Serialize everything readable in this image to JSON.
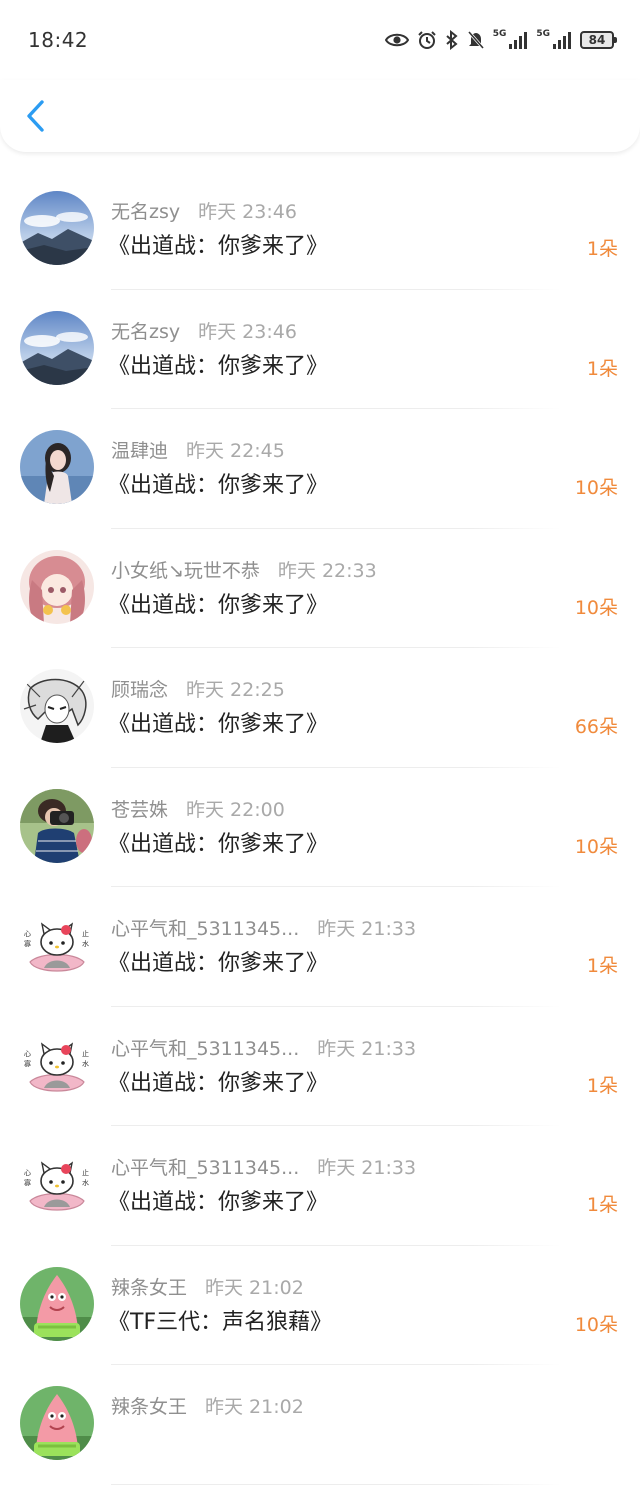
{
  "status_bar": {
    "time": "18:42",
    "network_1": "5G",
    "network_2": "5G",
    "battery": "84",
    "icons": [
      "eye-icon",
      "alarm-icon",
      "bluetooth-icon",
      "mute-icon",
      "signal-icon",
      "signal-icon"
    ]
  },
  "header": {
    "back_icon": "chevron-left-icon",
    "accent_color": "#2b9cf2"
  },
  "colors": {
    "amount": "#f08a3c",
    "name": "#8f8f8f",
    "title": "#222222"
  },
  "gifts": [
    {
      "user": "无名zsy",
      "time": "昨天 23:46",
      "title": "《出道战：你爹来了》",
      "amount": "1朵",
      "avatar": "mountain"
    },
    {
      "user": "无名zsy",
      "time": "昨天 23:46",
      "title": "《出道战：你爹来了》",
      "amount": "1朵",
      "avatar": "mountain"
    },
    {
      "user": "温肆迪",
      "time": "昨天 22:45",
      "title": "《出道战：你爹来了》",
      "amount": "10朵",
      "avatar": "girl"
    },
    {
      "user": "小女纸↘玩世不恭",
      "time": "昨天 22:33",
      "title": "《出道战：你爹来了》",
      "amount": "10朵",
      "avatar": "pink-anime"
    },
    {
      "user": "顾瑞念",
      "time": "昨天 22:25",
      "title": "《出道战：你爹来了》",
      "amount": "66朵",
      "avatar": "sketch"
    },
    {
      "user": "苍芸姝",
      "time": "昨天 22:00",
      "title": "《出道战：你爹来了》",
      "amount": "10朵",
      "avatar": "photographer"
    },
    {
      "user": "心平气和_5311345...",
      "time": "昨天 21:33",
      "title": "《出道战：你爹来了》",
      "amount": "1朵",
      "avatar": "kitty"
    },
    {
      "user": "心平气和_5311345...",
      "time": "昨天 21:33",
      "title": "《出道战：你爹来了》",
      "amount": "1朵",
      "avatar": "kitty"
    },
    {
      "user": "心平气和_5311345...",
      "time": "昨天 21:33",
      "title": "《出道战：你爹来了》",
      "amount": "1朵",
      "avatar": "kitty"
    },
    {
      "user": "辣条女王",
      "time": "昨天 21:02",
      "title": "《TF三代：声名狼藉》",
      "amount": "10朵",
      "avatar": "patrick"
    },
    {
      "user": "辣条女王",
      "time": "昨天 21:02",
      "title": "",
      "amount": "",
      "avatar": "patrick"
    }
  ]
}
